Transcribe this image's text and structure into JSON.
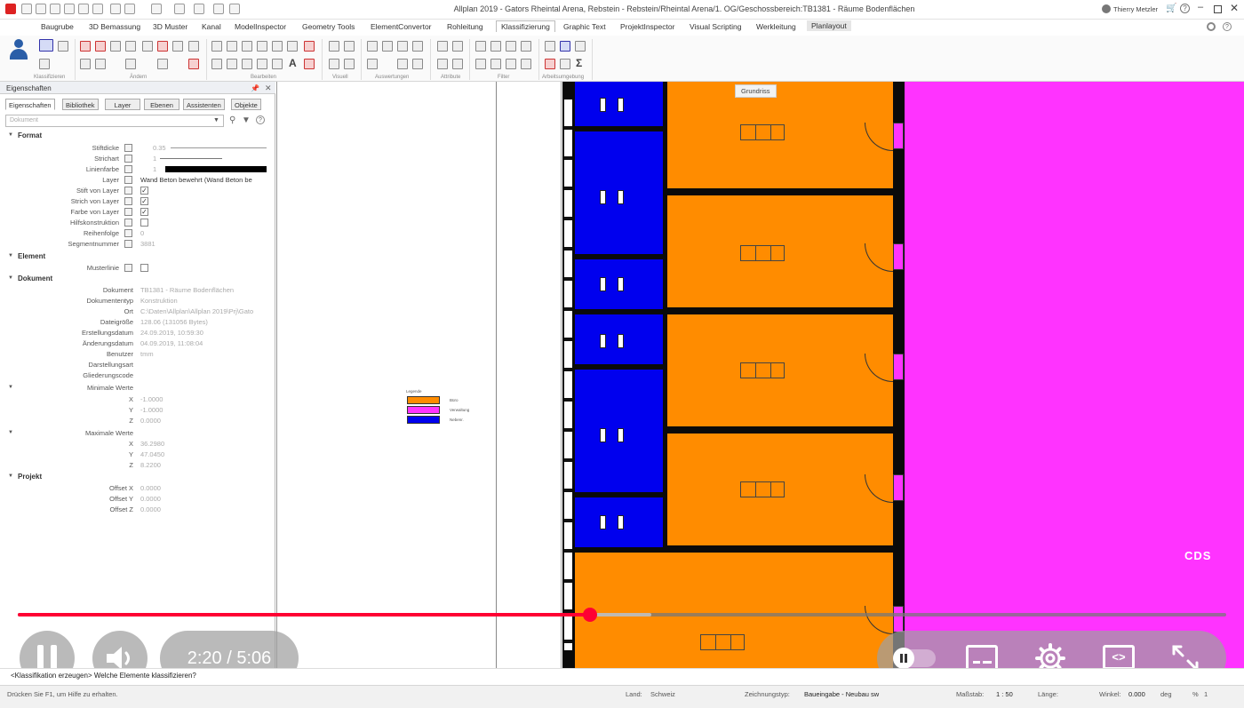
{
  "titlebar": {
    "title": "Allplan 2019 - Gators Rheintal Arena, Rebstein - Rebstein/Rheintal Arena/1. OG/Geschossbereich:TB1381 - Räume Bodenflächen",
    "user": "Thierry Metzler"
  },
  "ribbon_tabs": [
    "Baugrube",
    "3D Bemassung",
    "3D Muster",
    "Kanal",
    "ModelInspector",
    "Geometry Tools",
    "ElementConvertor",
    "Rohleitung",
    "Klassifizierung",
    "Graphic Text",
    "ProjektInspector",
    "Visual Scripting",
    "Werkleitung",
    "Planlayout"
  ],
  "ribbon_active": "Klassifizierung",
  "ribbon_groups": [
    "Klassifizieren",
    "Ändern",
    "Bearbeiten",
    "Visuell",
    "Auswertungen",
    "Attribute",
    "Filter",
    "Arbeitsumgebung"
  ],
  "panel": {
    "title": "Eigenschaften",
    "tabs": [
      "Eigenschaften",
      "Bibliothek",
      "Layer",
      "Ebenen",
      "Assistenten",
      "Objekte"
    ],
    "dropdown": "Dokument",
    "sections": {
      "format": "Format",
      "element": "Element",
      "dokument": "Dokument",
      "min": "Minimale Werte",
      "max": "Maximale Werte",
      "projekt": "Projekt"
    },
    "format": {
      "stiftdicke": {
        "label": "Stiftdicke",
        "value": "0.35"
      },
      "strichart": {
        "label": "Strichart",
        "value": "1"
      },
      "linienfarbe": {
        "label": "Linienfarbe",
        "value": "1"
      },
      "layer": {
        "label": "Layer",
        "value": "Wand Beton bewehrt (Wand Beton be"
      },
      "stift_von_layer": {
        "label": "Stift von Layer"
      },
      "strich_von_layer": {
        "label": "Strich von Layer"
      },
      "farbe_von_layer": {
        "label": "Farbe von Layer"
      },
      "hilfskonstruktion": {
        "label": "Hilfskonstruktion"
      },
      "reihenfolge": {
        "label": "Reihenfolge",
        "value": "0"
      },
      "segmentnummer": {
        "label": "Segmentnummer",
        "value": "3881"
      }
    },
    "element": {
      "musterlinie": {
        "label": "Musterlinie"
      }
    },
    "dokument": {
      "dokument": {
        "label": "Dokument",
        "value": "TB1381 - Räume Bodenflächen"
      },
      "dokumententyp": {
        "label": "Dokumententyp",
        "value": "Konstruktion"
      },
      "ort": {
        "label": "Ort",
        "value": "C:\\Daten\\Allplan\\Allplan 2019\\Prj\\Gato"
      },
      "dateigroesse": {
        "label": "Dateigröße",
        "value": "128.06 (131056 Bytes)"
      },
      "erstellungsdatum": {
        "label": "Erstellungsdatum",
        "value": "24.09.2019, 10:59:30"
      },
      "aenderungsdatum": {
        "label": "Änderungsdatum",
        "value": "04.09.2019, 11:08:04"
      },
      "benutzer": {
        "label": "Benutzer",
        "value": "tmm"
      },
      "darstellungsart": {
        "label": "Darstellungsart"
      },
      "gliederungscode": {
        "label": "Gliederungscode"
      }
    },
    "min": {
      "x": {
        "label": "X",
        "value": "-1.0000"
      },
      "y": {
        "label": "Y",
        "value": "-1.0000"
      },
      "z": {
        "label": "Z",
        "value": "0.0000"
      }
    },
    "max": {
      "x": {
        "label": "X",
        "value": "36.2980"
      },
      "y": {
        "label": "Y",
        "value": "47.0450"
      },
      "z": {
        "label": "Z",
        "value": "8.2200"
      }
    },
    "projekt": {
      "offset_x": {
        "label": "Offset X",
        "value": "0.0000"
      },
      "offset_y": {
        "label": "Offset Y",
        "value": "0.0000"
      },
      "offset_z": {
        "label": "Offset Z",
        "value": "0.0000"
      }
    }
  },
  "canvas": {
    "view_label": "Grundriss",
    "legend": {
      "title": "Legende",
      "items": [
        {
          "label": "Büro",
          "color": "#ff8c00"
        },
        {
          "label": "Verwaltung",
          "color": "#ff33ff"
        },
        {
          "label": "Nebenr.",
          "color": "#0000ee"
        }
      ]
    },
    "watermark": "CDS",
    "room_colors": {
      "orange": "#ff8c00",
      "blue": "#0000ee",
      "magenta": "#ff33ff"
    }
  },
  "video": {
    "time_current": "2:20",
    "time_total": "5:06",
    "progress": 0.4735,
    "buffered": 0.524,
    "accent": "#ff0033"
  },
  "prompt": {
    "text": "<Klassifikation erzeugen> Welche Elemente klassifizieren?"
  },
  "statusbar": {
    "hint": "Drücken Sie F1, um Hilfe zu erhalten.",
    "land_label": "Land:",
    "land": "Schweiz",
    "zeichnungstyp_label": "Zeichnungstyp:",
    "zeichnungstyp": "Baueingabe - Neubau sw",
    "massstab_label": "Maßstab:",
    "massstab": "1 : 50",
    "laenge_label": "Länge:",
    "winkel_label": "Winkel:",
    "winkel": "0.000",
    "grad": "deg",
    "prozent": "%",
    "prozent_val": "1"
  }
}
